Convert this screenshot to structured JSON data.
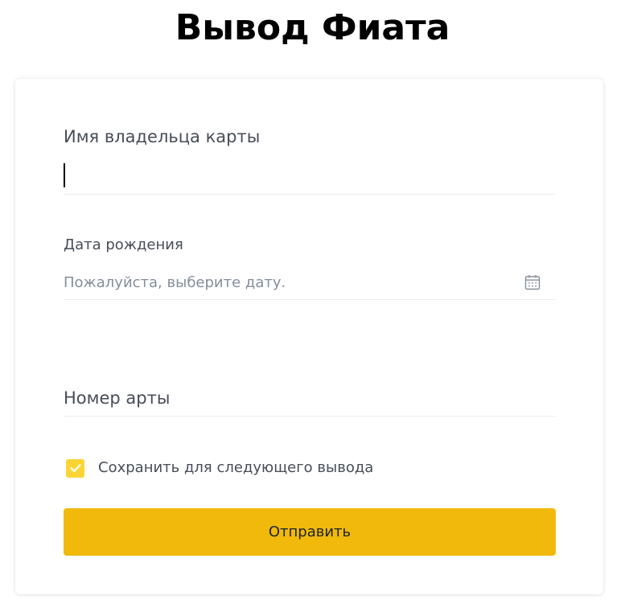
{
  "page": {
    "title": "Вывод Фиата"
  },
  "form": {
    "cardholder_name": {
      "label": "Имя владельца карты",
      "value": ""
    },
    "birth_date": {
      "label": "Дата рождения",
      "placeholder": "Пожалуйста, выберите дату.",
      "icon": "calendar-icon"
    },
    "card_number": {
      "label": "Номер арты",
      "value": ""
    },
    "save_checkbox": {
      "label": "Сохранить для следующего вывода",
      "checked": true,
      "icon": "check-icon"
    },
    "submit_label": "Отправить"
  },
  "colors": {
    "accent": "#f0b90b",
    "checkbox": "#fcd535",
    "label_text": "#474d57",
    "placeholder_text": "#848e9c",
    "divider": "#eaecef"
  }
}
